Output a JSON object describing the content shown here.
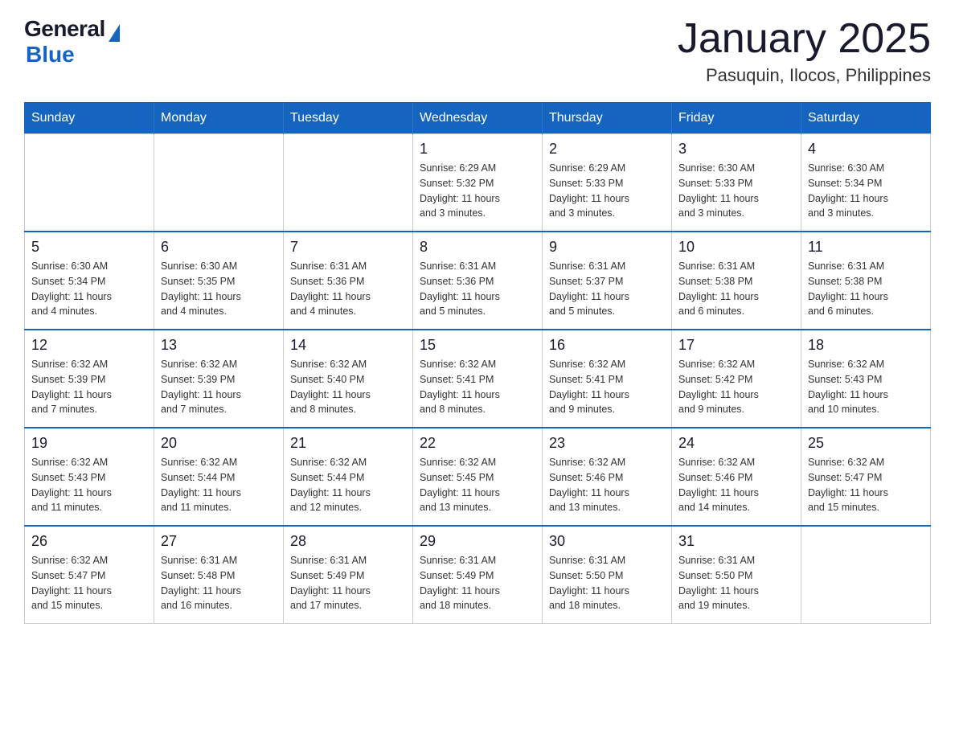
{
  "header": {
    "logo": {
      "general": "General",
      "blue": "Blue"
    },
    "title": "January 2025",
    "location": "Pasuquin, Ilocos, Philippines"
  },
  "days_of_week": [
    "Sunday",
    "Monday",
    "Tuesday",
    "Wednesday",
    "Thursday",
    "Friday",
    "Saturday"
  ],
  "weeks": [
    {
      "days": [
        {
          "num": "",
          "info": ""
        },
        {
          "num": "",
          "info": ""
        },
        {
          "num": "",
          "info": ""
        },
        {
          "num": "1",
          "info": "Sunrise: 6:29 AM\nSunset: 5:32 PM\nDaylight: 11 hours\nand 3 minutes."
        },
        {
          "num": "2",
          "info": "Sunrise: 6:29 AM\nSunset: 5:33 PM\nDaylight: 11 hours\nand 3 minutes."
        },
        {
          "num": "3",
          "info": "Sunrise: 6:30 AM\nSunset: 5:33 PM\nDaylight: 11 hours\nand 3 minutes."
        },
        {
          "num": "4",
          "info": "Sunrise: 6:30 AM\nSunset: 5:34 PM\nDaylight: 11 hours\nand 3 minutes."
        }
      ]
    },
    {
      "days": [
        {
          "num": "5",
          "info": "Sunrise: 6:30 AM\nSunset: 5:34 PM\nDaylight: 11 hours\nand 4 minutes."
        },
        {
          "num": "6",
          "info": "Sunrise: 6:30 AM\nSunset: 5:35 PM\nDaylight: 11 hours\nand 4 minutes."
        },
        {
          "num": "7",
          "info": "Sunrise: 6:31 AM\nSunset: 5:36 PM\nDaylight: 11 hours\nand 4 minutes."
        },
        {
          "num": "8",
          "info": "Sunrise: 6:31 AM\nSunset: 5:36 PM\nDaylight: 11 hours\nand 5 minutes."
        },
        {
          "num": "9",
          "info": "Sunrise: 6:31 AM\nSunset: 5:37 PM\nDaylight: 11 hours\nand 5 minutes."
        },
        {
          "num": "10",
          "info": "Sunrise: 6:31 AM\nSunset: 5:38 PM\nDaylight: 11 hours\nand 6 minutes."
        },
        {
          "num": "11",
          "info": "Sunrise: 6:31 AM\nSunset: 5:38 PM\nDaylight: 11 hours\nand 6 minutes."
        }
      ]
    },
    {
      "days": [
        {
          "num": "12",
          "info": "Sunrise: 6:32 AM\nSunset: 5:39 PM\nDaylight: 11 hours\nand 7 minutes."
        },
        {
          "num": "13",
          "info": "Sunrise: 6:32 AM\nSunset: 5:39 PM\nDaylight: 11 hours\nand 7 minutes."
        },
        {
          "num": "14",
          "info": "Sunrise: 6:32 AM\nSunset: 5:40 PM\nDaylight: 11 hours\nand 8 minutes."
        },
        {
          "num": "15",
          "info": "Sunrise: 6:32 AM\nSunset: 5:41 PM\nDaylight: 11 hours\nand 8 minutes."
        },
        {
          "num": "16",
          "info": "Sunrise: 6:32 AM\nSunset: 5:41 PM\nDaylight: 11 hours\nand 9 minutes."
        },
        {
          "num": "17",
          "info": "Sunrise: 6:32 AM\nSunset: 5:42 PM\nDaylight: 11 hours\nand 9 minutes."
        },
        {
          "num": "18",
          "info": "Sunrise: 6:32 AM\nSunset: 5:43 PM\nDaylight: 11 hours\nand 10 minutes."
        }
      ]
    },
    {
      "days": [
        {
          "num": "19",
          "info": "Sunrise: 6:32 AM\nSunset: 5:43 PM\nDaylight: 11 hours\nand 11 minutes."
        },
        {
          "num": "20",
          "info": "Sunrise: 6:32 AM\nSunset: 5:44 PM\nDaylight: 11 hours\nand 11 minutes."
        },
        {
          "num": "21",
          "info": "Sunrise: 6:32 AM\nSunset: 5:44 PM\nDaylight: 11 hours\nand 12 minutes."
        },
        {
          "num": "22",
          "info": "Sunrise: 6:32 AM\nSunset: 5:45 PM\nDaylight: 11 hours\nand 13 minutes."
        },
        {
          "num": "23",
          "info": "Sunrise: 6:32 AM\nSunset: 5:46 PM\nDaylight: 11 hours\nand 13 minutes."
        },
        {
          "num": "24",
          "info": "Sunrise: 6:32 AM\nSunset: 5:46 PM\nDaylight: 11 hours\nand 14 minutes."
        },
        {
          "num": "25",
          "info": "Sunrise: 6:32 AM\nSunset: 5:47 PM\nDaylight: 11 hours\nand 15 minutes."
        }
      ]
    },
    {
      "days": [
        {
          "num": "26",
          "info": "Sunrise: 6:32 AM\nSunset: 5:47 PM\nDaylight: 11 hours\nand 15 minutes."
        },
        {
          "num": "27",
          "info": "Sunrise: 6:31 AM\nSunset: 5:48 PM\nDaylight: 11 hours\nand 16 minutes."
        },
        {
          "num": "28",
          "info": "Sunrise: 6:31 AM\nSunset: 5:49 PM\nDaylight: 11 hours\nand 17 minutes."
        },
        {
          "num": "29",
          "info": "Sunrise: 6:31 AM\nSunset: 5:49 PM\nDaylight: 11 hours\nand 18 minutes."
        },
        {
          "num": "30",
          "info": "Sunrise: 6:31 AM\nSunset: 5:50 PM\nDaylight: 11 hours\nand 18 minutes."
        },
        {
          "num": "31",
          "info": "Sunrise: 6:31 AM\nSunset: 5:50 PM\nDaylight: 11 hours\nand 19 minutes."
        },
        {
          "num": "",
          "info": ""
        }
      ]
    }
  ]
}
